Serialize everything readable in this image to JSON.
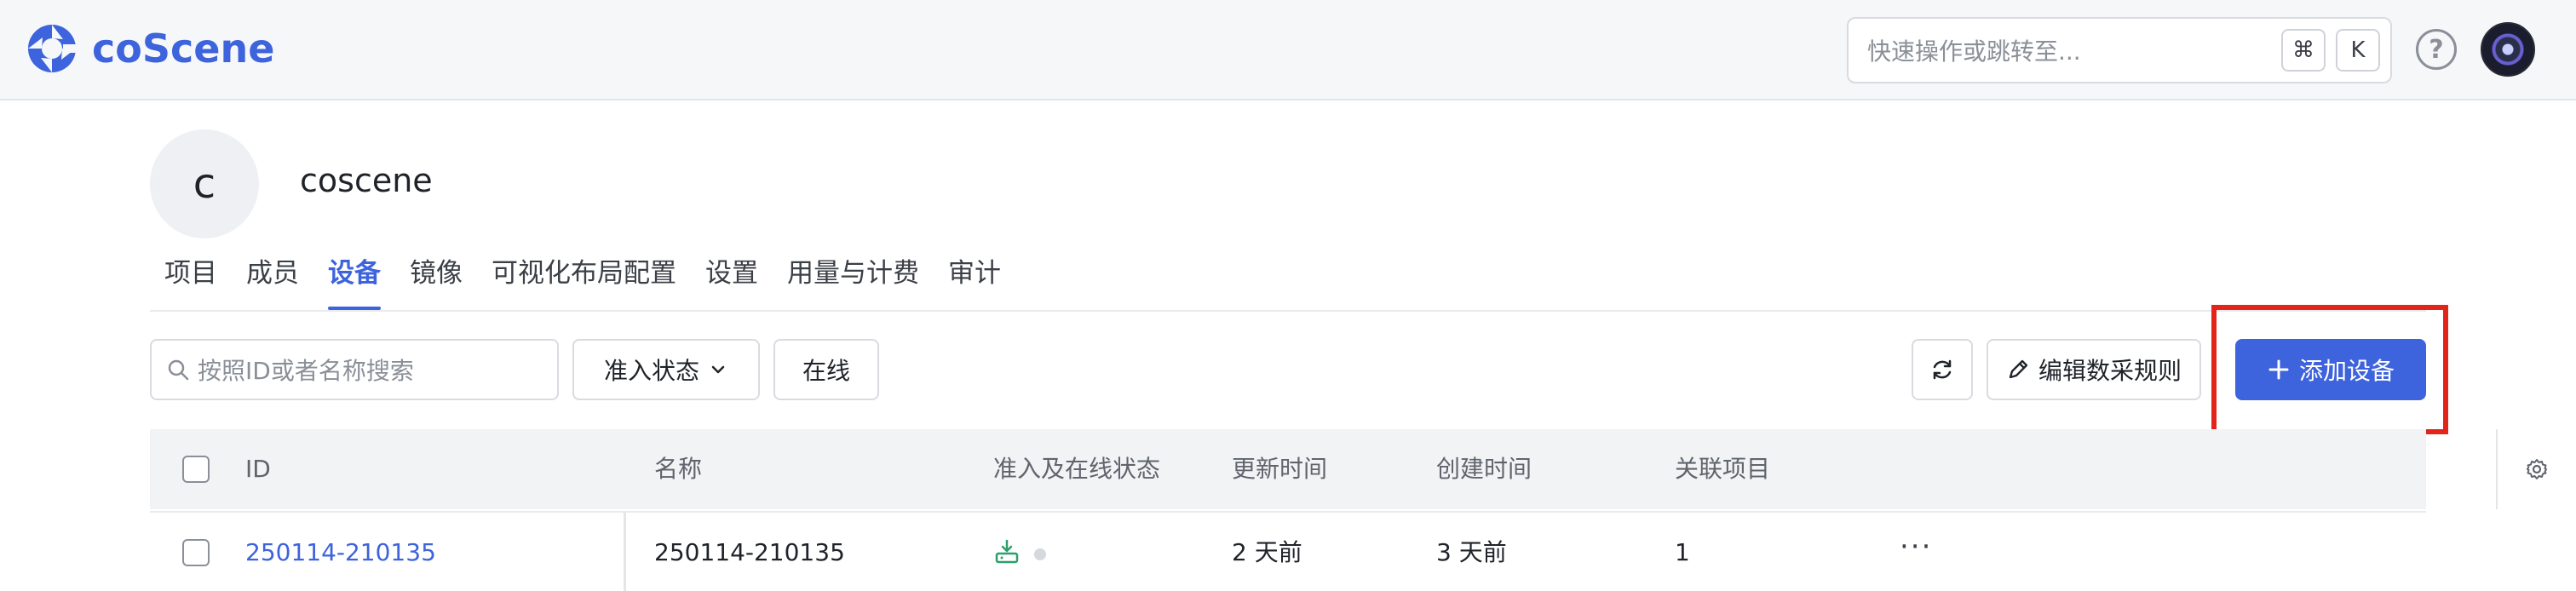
{
  "header": {
    "logo_text": "coScene",
    "command_placeholder": "快速操作或跳转至...",
    "shortcut_keys": [
      "⌘",
      "K"
    ],
    "help_icon": "question-circle-icon",
    "avatar": "user-avatar"
  },
  "org": {
    "avatar_letter": "c",
    "name": "coscene"
  },
  "tabs": [
    {
      "label": "项目",
      "active": false
    },
    {
      "label": "成员",
      "active": false
    },
    {
      "label": "设备",
      "active": true
    },
    {
      "label": "镜像",
      "active": false
    },
    {
      "label": "可视化布局配置",
      "active": false
    },
    {
      "label": "设置",
      "active": false
    },
    {
      "label": "用量与计费",
      "active": false
    },
    {
      "label": "审计",
      "active": false
    }
  ],
  "toolbar": {
    "search_placeholder": "按照ID或者名称搜索",
    "status_filter_label": "准入状态",
    "online_label": "在线",
    "edit_rules_label": "编辑数采规则",
    "add_device_label": "添加设备"
  },
  "table": {
    "columns": [
      "ID",
      "名称",
      "准入及在线状态",
      "更新时间",
      "创建时间",
      "关联项目"
    ],
    "rows": [
      {
        "id": "250114-210135",
        "name": "250114-210135",
        "updated": "2 天前",
        "created": "3 天前",
        "projects": "1",
        "more": "···"
      }
    ]
  },
  "colors": {
    "accent": "#3d63dd",
    "highlight": "#e3241b",
    "admitted": "#2e9e6a"
  }
}
